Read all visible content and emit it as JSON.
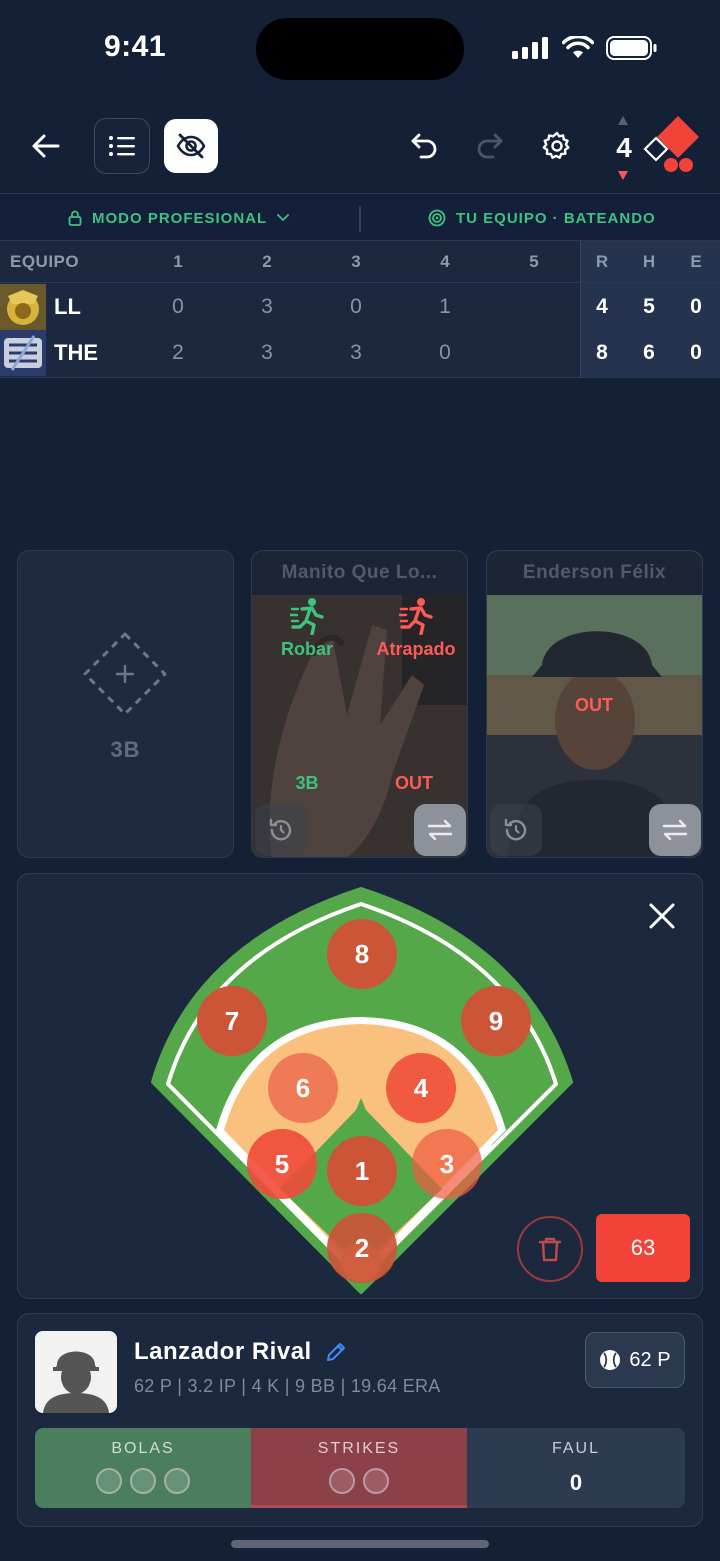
{
  "status": {
    "time": "9:41"
  },
  "toolbar": {
    "inning": "4"
  },
  "mode": {
    "left_label": "MODO PROFESIONAL",
    "right_label": "TU EQUIPO · BATEANDO"
  },
  "scoreboard": {
    "header": [
      "EQUIPO",
      "1",
      "2",
      "3",
      "4",
      "5",
      "R",
      "H",
      "E"
    ],
    "rows": [
      {
        "team": "LL",
        "innings": [
          "0",
          "3",
          "0",
          "1",
          ""
        ],
        "r": "4",
        "h": "5",
        "e": "0"
      },
      {
        "team": "THE",
        "innings": [
          "2",
          "3",
          "3",
          "0",
          ""
        ],
        "r": "8",
        "h": "6",
        "e": "0"
      }
    ]
  },
  "bases": {
    "empty_base_label": "3B",
    "runner": {
      "name": "Manito Que Lo...",
      "action_steal": "Robar",
      "action_caught": "Atrapado",
      "safe_label": "3B",
      "out_label": "OUT"
    },
    "batter": {
      "name": "Enderson Félix",
      "out_label": "OUT"
    }
  },
  "field": {
    "positions": [
      "1",
      "2",
      "3",
      "4",
      "5",
      "6",
      "7",
      "8",
      "9"
    ],
    "pitch_button": "63"
  },
  "pitcher": {
    "name": "Lanzador Rival",
    "stats": "62 P | 3.2 IP | 4 K | 9 BB | 19.64 ERA",
    "pitch_count": "62 P"
  },
  "count": {
    "balls_label": "BOLAS",
    "strikes_label": "STRIKES",
    "foul_label": "FAUL",
    "foul_value": "0",
    "balls": 3,
    "strikes": 2
  },
  "colors": {
    "accent_green": "#3ec27e",
    "accent_red": "#f24338",
    "background": "#142036"
  }
}
